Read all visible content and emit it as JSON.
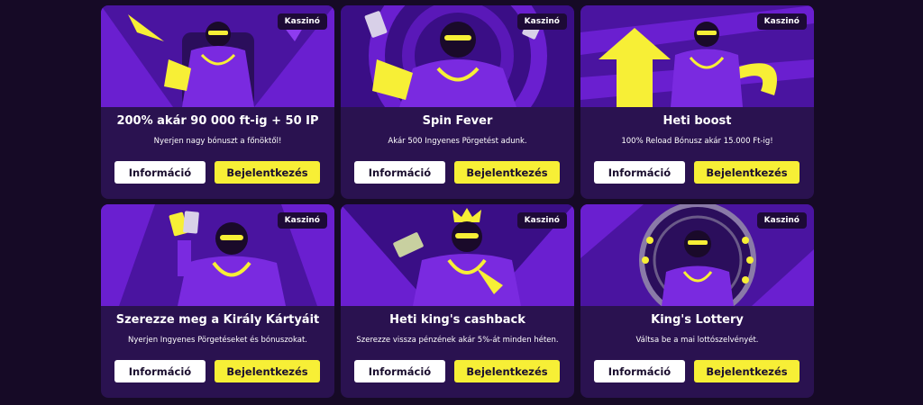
{
  "colors": {
    "page_bg": "#160a26",
    "card_bg": "#2a1250",
    "accent_yellow": "#f7ef36",
    "art_purple": "#6a1fd0",
    "art_dark": "#1d0a36"
  },
  "cards": [
    {
      "badge": "Kaszinó",
      "title": "200% akár 90 000 ft-ig + 50 IP",
      "description": "Nyerjen nagy bónuszt a főnöktől!",
      "info_label": "Információ",
      "login_label": "Bejelentkezés",
      "art": "king-on-throne-illustration"
    },
    {
      "badge": "Kaszinó",
      "title": "Spin Fever",
      "description": "Akár 500 Ingyenes Pörgetést adunk.",
      "info_label": "Információ",
      "login_label": "Bejelentkezés",
      "art": "king-spinning-illustration"
    },
    {
      "badge": "Kaszinó",
      "title": "Heti boost",
      "description": "100% Reload Bónusz akár 15.000 Ft-ig!",
      "info_label": "Információ",
      "login_label": "Bejelentkezés",
      "art": "king-with-arrow-illustration"
    },
    {
      "badge": "Kaszinó",
      "title": "Szerezze meg a Király Kártyáit",
      "description": "Nyerjen Ingyenes Pörgetéseket és bónuszokat.",
      "info_label": "Információ",
      "login_label": "Bejelentkezés",
      "art": "king-with-cards-illustration"
    },
    {
      "badge": "Kaszinó",
      "title": "Heti king's cashback",
      "description": "Szerezze vissza pénzének akár 5%-át minden héten.",
      "info_label": "Információ",
      "login_label": "Bejelentkezés",
      "art": "king-with-cash-illustration"
    },
    {
      "badge": "Kaszinó",
      "title": "King's Lottery",
      "description": "Váltsa be a mai lottószelvényét.",
      "info_label": "Információ",
      "login_label": "Bejelentkezés",
      "art": "king-with-lottery-wheel-illustration"
    }
  ]
}
